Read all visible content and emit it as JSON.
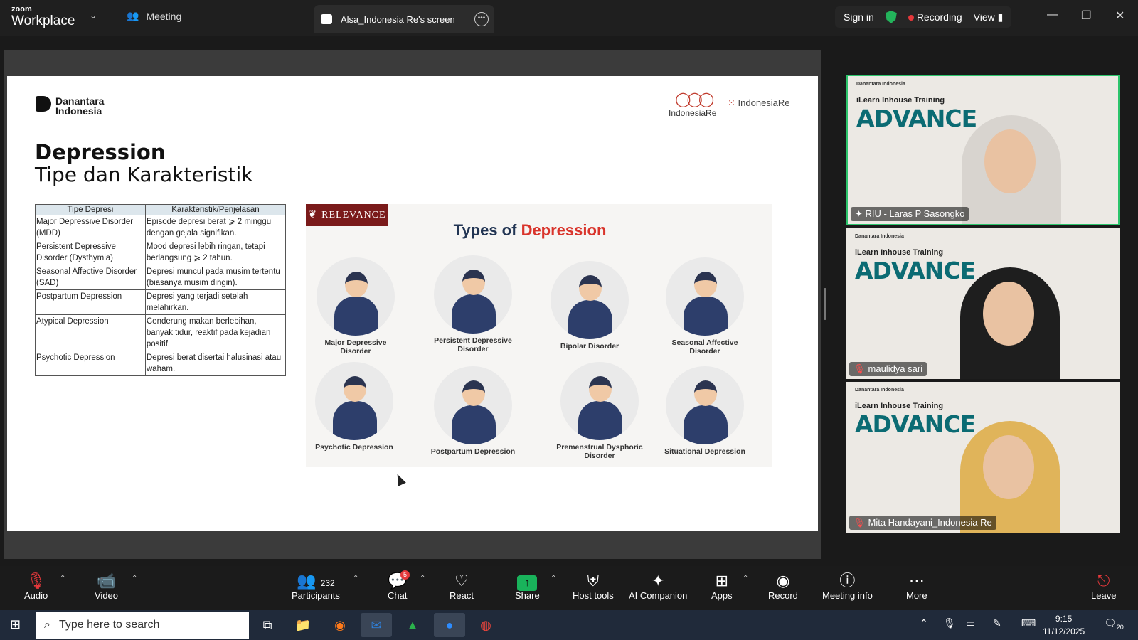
{
  "titlebar": {
    "brand_top": "zoom",
    "brand_bottom": "Workplace",
    "meeting_tab": "Meeting",
    "screen_tab": "Alsa_Indonesia Re's screen",
    "sign_in": "Sign in",
    "recording": "Recording",
    "view": "View"
  },
  "slide": {
    "org_logo": "Danantara\nIndonesia",
    "partner_logo": "IndonesiaRe",
    "institute_logo": "IndonesiaRe",
    "title": "Depression",
    "subtitle": "Tipe dan Karakteristik",
    "table": {
      "headers": [
        "Tipe Depresi",
        "Karakteristik/Penjelasan"
      ],
      "rows": [
        [
          "Major Depressive Disorder (MDD)",
          "Episode depresi berat ⩾ 2 minggu dengan gejala signifikan."
        ],
        [
          "Persistent Depressive Disorder (Dysthymia)",
          "Mood depresi lebih ringan, tetapi berlangsung ⩾ 2 tahun."
        ],
        [
          "Seasonal Affective Disorder (SAD)",
          "Depresi muncul pada musim tertentu (biasanya musim dingin)."
        ],
        [
          "Postpartum Depression",
          "Depresi yang terjadi setelah melahirkan."
        ],
        [
          "Atypical Depression",
          "Cenderung makan berlebihan, banyak tidur, reaktif pada kejadian positif."
        ],
        [
          "Psychotic Depression",
          "Depresi berat disertai halusinasi atau waham."
        ]
      ]
    },
    "relevance": {
      "badge": "RELEVANCE",
      "title_a": "Types of ",
      "title_b": "Depression",
      "figures": [
        "Major Depressive Disorder",
        "Persistent Depressive Disorder",
        "Bipolar Disorder",
        "Seasonal Affective Disorder",
        "Psychotic Depression",
        "Postpartum Depression",
        "Premenstrual Dysphoric Disorder",
        "Situational Depression"
      ]
    }
  },
  "gallery": {
    "banner_small": "Danantara Indonesia",
    "banner_sub": "iLearn Inhouse Training",
    "banner_big": "ADVANCE",
    "participants": [
      {
        "name": "RIU - Laras P Sasongko",
        "active": true
      },
      {
        "name": "maulidya sari",
        "active": false
      },
      {
        "name": "Mita Handayani_Indonesia Re",
        "active": false
      }
    ]
  },
  "toolbar": {
    "audio": "Audio",
    "video": "Video",
    "participants": "Participants",
    "participant_count": "232",
    "chat": "Chat",
    "chat_badge": "5",
    "react": "React",
    "share": "Share",
    "host_tools": "Host tools",
    "ai_companion": "AI Companion",
    "apps": "Apps",
    "record": "Record",
    "meeting_info": "Meeting info",
    "more": "More",
    "leave": "Leave"
  },
  "taskbar": {
    "search_placeholder": "Type here to search",
    "time": "9:15",
    "date": "11/12/2025",
    "notifications": "20"
  },
  "colors": {
    "accent_green": "#2cc46b",
    "recording_red": "#e5383b",
    "slide_title_red": "#d9342b",
    "relevance_badge": "#7a1a1a",
    "banner_teal": "#0b6b73"
  }
}
